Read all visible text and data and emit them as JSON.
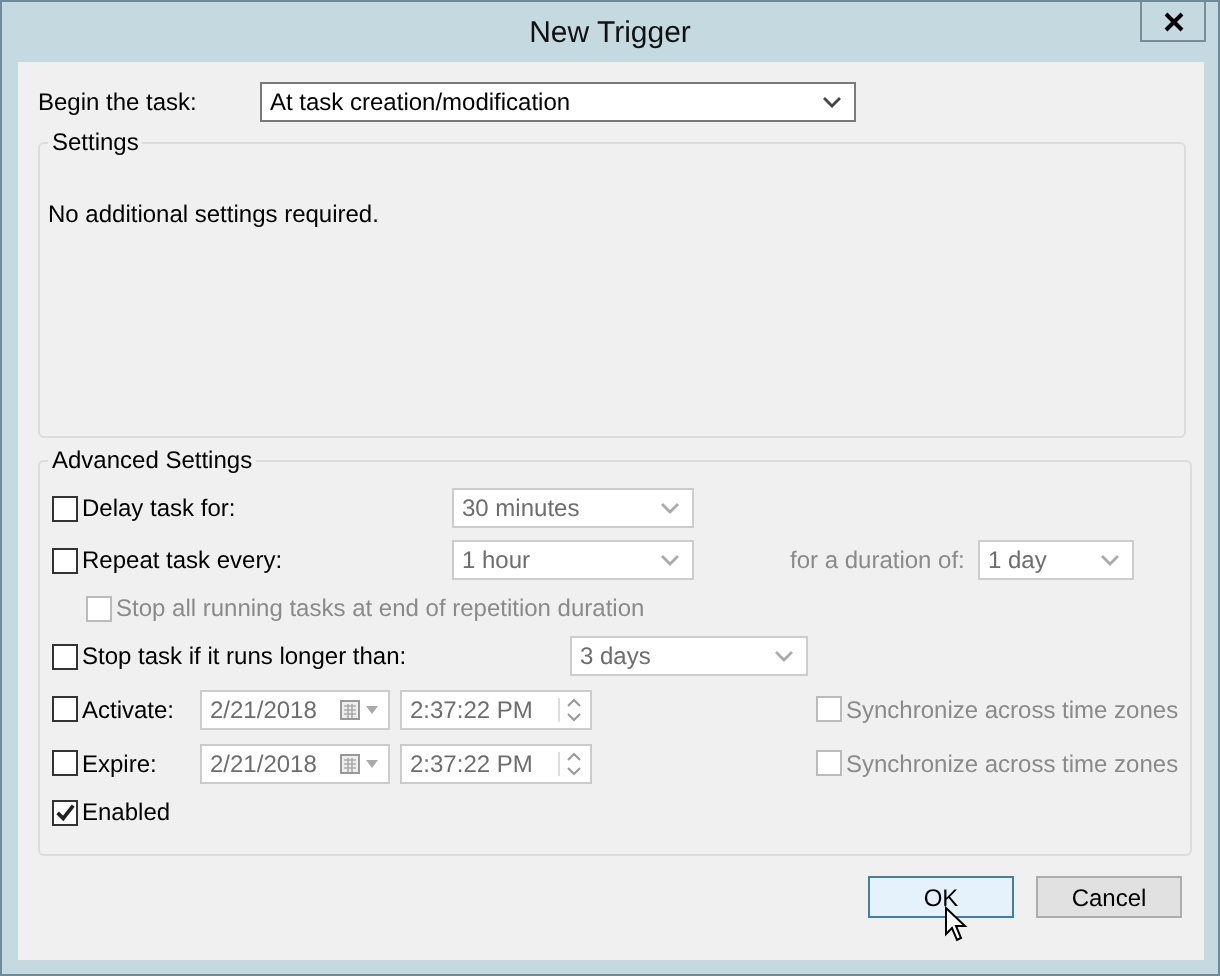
{
  "window": {
    "title": "New Trigger"
  },
  "begin": {
    "label": "Begin the task:",
    "value": "At task creation/modification"
  },
  "settings": {
    "title": "Settings",
    "message": "No additional settings required."
  },
  "advanced": {
    "title": "Advanced Settings",
    "options": [
      {
        "kind": "combo",
        "label": "Delay task for:",
        "checked": false,
        "value": "30 minutes",
        "disabled": true
      },
      {
        "kind": "combo",
        "label": "Repeat task every:",
        "checked": false,
        "value": "1 hour",
        "disabled": true,
        "duration": {
          "label": "for a duration of:",
          "value": "1 day",
          "disabled": true
        }
      },
      {
        "kind": "sub",
        "label": "Stop all running tasks at end of repetition duration",
        "checked": false,
        "disabled": true
      },
      {
        "kind": "timeout",
        "label": "Stop task if it runs longer than:",
        "checked": false,
        "value": "3 days",
        "disabled": true
      },
      {
        "kind": "datetime",
        "label": "Activate:",
        "checked": false,
        "date": "2/21/2018",
        "time": "2:37:22 PM",
        "disabled": true,
        "sync": {
          "label": "Synchronize across time zones",
          "checked": false,
          "disabled": true
        }
      },
      {
        "kind": "datetime",
        "label": "Expire:",
        "checked": false,
        "date": "2/21/2018",
        "time": "2:37:22 PM",
        "disabled": true,
        "sync": {
          "label": "Synchronize across time zones",
          "checked": false,
          "disabled": true
        }
      },
      {
        "kind": "check",
        "label": "Enabled",
        "checked": true,
        "disabled": false
      }
    ]
  },
  "buttons": [
    {
      "label": "OK",
      "focused": true
    },
    {
      "label": "Cancel",
      "focused": false
    }
  ]
}
